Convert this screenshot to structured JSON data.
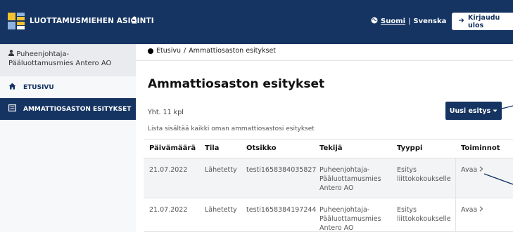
{
  "header": {
    "brand": "LUOTTAMUSMIEHEN ASIOINTI",
    "languages": {
      "active": "Suomi",
      "separator": "|",
      "other": "Svenska"
    },
    "logout_label": "Kirjaudu ulos"
  },
  "sidebar": {
    "user": "Puheenjohtaja-Pääluottamusmies Antero AO",
    "items": [
      {
        "label": "ETUSIVU",
        "icon": "home-icon"
      },
      {
        "label": "AMMATTIOSASTON ESITYKSET",
        "icon": "list-icon"
      }
    ]
  },
  "breadcrumb": {
    "home": "Etusivu",
    "separator": "/",
    "current": "Ammattiosaston esitykset"
  },
  "main": {
    "title": "Ammattiosaston esitykset",
    "count": "Yht. 11 kpl",
    "new_button": "Uusi esitys",
    "info": "Lista sisältää kaikki oman ammattiosastosi esitykset"
  },
  "table": {
    "headers": [
      "Päivämäärä",
      "Tila",
      "Otsikko",
      "Tekijä",
      "Tyyppi",
      "Toiminnot"
    ],
    "rows": [
      {
        "date": "21.07.2022",
        "status": "Lähetetty",
        "title": "testi1658384035827",
        "author": [
          "Puheenjohtaja-",
          "Pääluottamusmies",
          "Antero AO"
        ],
        "type": [
          "Esitys",
          "liittokokoukselle"
        ],
        "action": "Avaa"
      },
      {
        "date": "21.07.2022",
        "status": "Lähetetty",
        "title": "testi1658384197244",
        "author": [
          "Puheenjohtaja-",
          "Pääluottamusmies",
          "Antero AO"
        ],
        "type": [
          "Esitys",
          "liittokokoukselle"
        ],
        "action": "Avaa"
      }
    ]
  },
  "colors": {
    "navy": "#153462",
    "sidebar_bg": "#e9ebee",
    "accent_yellow": "#f2c230"
  }
}
